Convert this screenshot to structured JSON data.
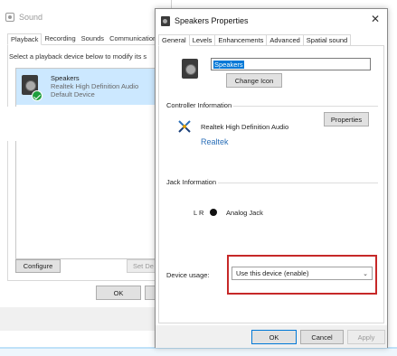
{
  "sound": {
    "title": "Sound",
    "tabs": [
      "Playback",
      "Recording",
      "Sounds",
      "Communications"
    ],
    "active_tab": "Playback",
    "instruction": "Select a playback device below to modify its s",
    "device": {
      "name": "Speakers",
      "driver": "Realtek High Definition Audio",
      "status": "Default Device"
    },
    "configure_label": "Configure",
    "set_default_label": "Set De",
    "ok_label": "OK"
  },
  "props": {
    "title": "Speakers Properties",
    "tabs": [
      "General",
      "Levels",
      "Enhancements",
      "Advanced",
      "Spatial sound"
    ],
    "active_tab": "General",
    "device_name_value": "Speakers",
    "change_icon_label": "Change Icon",
    "controller_info_label": "Controller Information",
    "controller_name": "Realtek High Definition Audio",
    "controller_properties_label": "Properties",
    "controller_link": "Realtek",
    "jack_info_label": "Jack Information",
    "jack_channels": "L R",
    "jack_type": "Analog Jack",
    "device_usage_label": "Device usage:",
    "device_usage_value": "Use this device (enable)",
    "ok_label": "OK",
    "cancel_label": "Cancel",
    "apply_label": "Apply"
  },
  "colors": {
    "selection": "#cce8ff",
    "accent": "#0078d7",
    "highlight_box": "#c62828",
    "default_check": "#1e9e3e",
    "link": "#2b6fb8"
  },
  "icons": {
    "sound_window": "speaker-icon",
    "device": "speaker-device-icon",
    "default_badge": "checkmark-badge-icon",
    "controller": "realtek-controller-icon",
    "jack": "jack-dot-icon",
    "dropdown": "chevron-down-icon",
    "close": "close-icon"
  }
}
